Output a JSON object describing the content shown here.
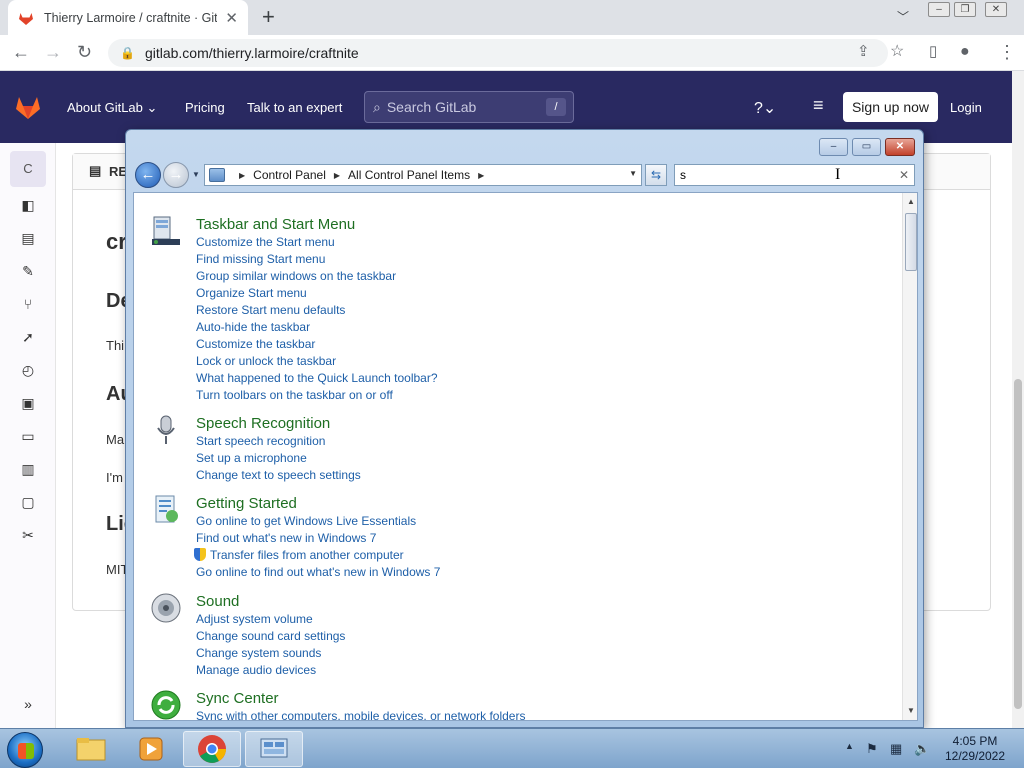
{
  "browser": {
    "tab_title": "Thierry Larmoire / craftnite · GitL",
    "url": "gitlab.com/thierry.larmoire/craftnite",
    "new_tab_symbol": "+",
    "tab_close_symbol": "✕"
  },
  "gitlab": {
    "nav": {
      "about": "About GitLab",
      "pricing": "Pricing",
      "talk": "Talk to an expert",
      "search_placeholder": "Search GitLab",
      "search_shortcut": "/",
      "signup": "Sign up now",
      "login": "Login"
    },
    "sidebar_avatar_letter": "C",
    "readme": {
      "header": "RE",
      "h1": "cr",
      "h2_1": "De",
      "p1": "Thi",
      "h2_2": "Au",
      "p2": "Ma",
      "p3": "I'm",
      "h2_3": "Lic",
      "p4": "MIT"
    }
  },
  "control_panel": {
    "breadcrumb": [
      "Control Panel",
      "All Control Panel Items"
    ],
    "search_value": "s",
    "categories": [
      {
        "icon": "taskbar-icon",
        "title": "Taskbar and Start Menu",
        "tasks": [
          "Customize the Start menu",
          "Find missing Start menu",
          "Group similar windows on the taskbar",
          "Organize Start menu",
          "Restore Start menu defaults",
          "Auto-hide the taskbar",
          "Customize the taskbar",
          "Lock or unlock the taskbar",
          "What happened to the Quick Launch toolbar?",
          "Turn toolbars on the taskbar on or off"
        ]
      },
      {
        "icon": "microphone-icon",
        "title": "Speech Recognition",
        "tasks": [
          "Start speech recognition",
          "Set up a microphone",
          "Change text to speech settings"
        ]
      },
      {
        "icon": "getting-started-icon",
        "title": "Getting Started",
        "tasks": [
          "Go online to get Windows Live Essentials",
          "Find out what's new in Windows 7",
          "Transfer files from another computer",
          "Go online to find out what's new in Windows 7"
        ]
      },
      {
        "icon": "speaker-icon",
        "title": "Sound",
        "tasks": [
          "Adjust system volume",
          "Change sound card settings",
          "Change system sounds",
          "Manage audio devices"
        ]
      },
      {
        "icon": "sync-icon",
        "title": "Sync Center",
        "tasks": [
          "Sync with other computers, mobile devices, or network folders"
        ]
      }
    ]
  },
  "taskbar": {
    "time": "4:05 PM",
    "date": "12/29/2022"
  },
  "colors": {
    "gitlab_nav": "#292961",
    "cp_category": "#1e6f22",
    "cp_task_link": "#1e5fa8"
  }
}
